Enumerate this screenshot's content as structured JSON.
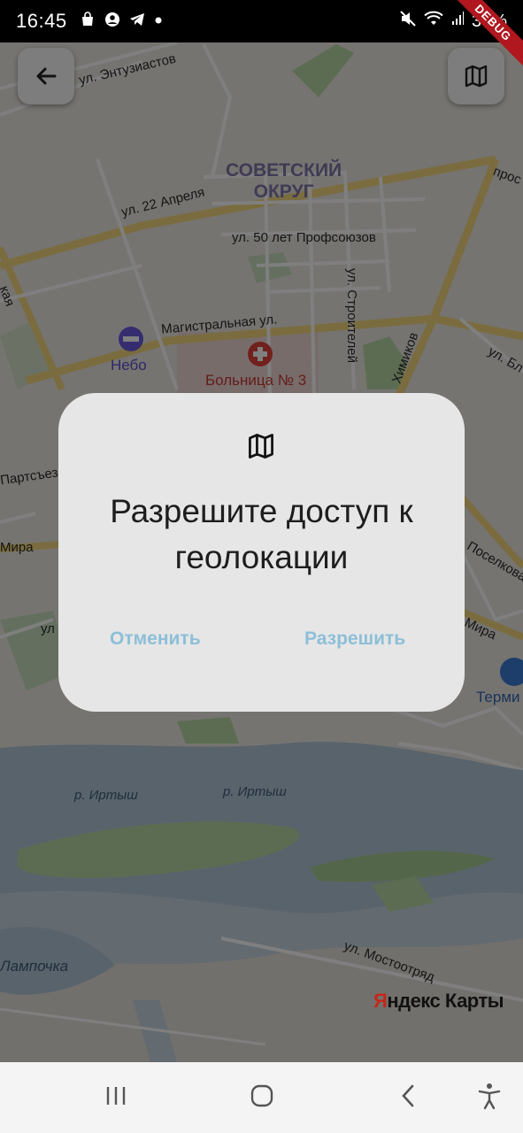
{
  "status_bar": {
    "time": "16:45",
    "battery": "35%",
    "debug_label": "DEBUG",
    "icons_left": [
      "shopping-bag-icon",
      "account-circle-icon",
      "telegram-icon",
      "dot-icon"
    ],
    "icons_right": [
      "mute-icon",
      "wifi-icon",
      "signal-icon"
    ]
  },
  "map": {
    "labels": {
      "district": "СОВЕТСКИЙ\nОКРУГ",
      "entuziastov": "ул. Энтузиастов",
      "april22": "ул. 22 Апреля",
      "profsoyuzov": "ул. 50 лет Профсоюзов",
      "magistralnaya": "Магистральная ул.",
      "stroiteley": "ул. Строителей",
      "himikov": "Химиков",
      "nebo": "Небо",
      "hospital": "Больница № 3",
      "partsyezda": "Партсъез",
      "mira_left": "Мира",
      "mira_right": "Мира",
      "poselkovaya": "Поселкова",
      "irtysh1": "р. Иртыш",
      "irtysh2": "р. Иртыш",
      "lampochka": "Лампочка",
      "mostootryad": "ул. Мостоотряд",
      "termi": "Терми",
      "pros": "прос",
      "ul_bl": "ул. Бл",
      "ul_left": "ул",
      "kaya": "кая"
    },
    "logo_prefix": "Я",
    "logo_rest": "ндекс Карты"
  },
  "buttons": {
    "back": "back-arrow-icon",
    "map_layers": "map-icon"
  },
  "dialog": {
    "icon": "map-icon",
    "title": "Разрешите доступ к геолокации",
    "cancel": "Отменить",
    "allow": "Разрешить"
  },
  "nav_bar": {
    "recents": "recents-icon",
    "home": "home-icon",
    "back": "nav-back-icon",
    "accessibility": "accessibility-icon"
  },
  "colors": {
    "dialog_bg": "#e6e6e6",
    "dialog_button": "#8cbfd8",
    "river": "#5b6e7c"
  }
}
